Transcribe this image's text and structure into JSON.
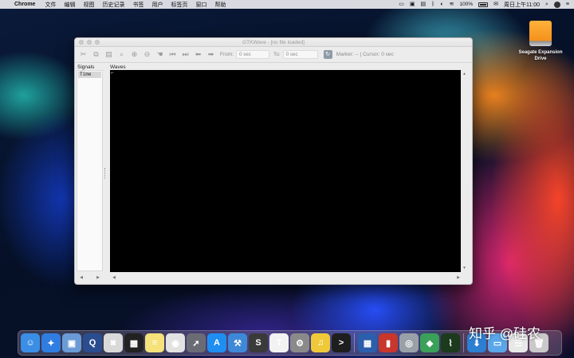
{
  "menubar": {
    "app_name": "Chrome",
    "items": [
      "文件",
      "编辑",
      "视图",
      "历史记录",
      "书签",
      "用户",
      "标签页",
      "窗口",
      "帮助"
    ],
    "battery_percent": "100%",
    "clock": "周日上午11:00",
    "status_icons": [
      "bluetooth-icon",
      "wifi-icon",
      "battery-icon",
      "input-source-icon",
      "search-icon",
      "user-avatar-icon",
      "notification-icon"
    ]
  },
  "desktop": {
    "drive_label": "Seagate Expansion Drive"
  },
  "window": {
    "title": "GTKWave - [no file loaded]",
    "toolbar": {
      "from_label": "From:",
      "from_value": "0 sec",
      "to_label": "To:",
      "to_value": "0 sec",
      "marker_label": "Marker: --  |  Cursor: 0 sec",
      "buttons": [
        "cut-icon",
        "copy-icon",
        "paste-icon",
        "zoom-fit-icon",
        "zoom-in-icon",
        "zoom-out-icon",
        "zoom-undo-icon",
        "jump-start-icon",
        "jump-end-icon",
        "page-left-icon",
        "page-right-icon"
      ]
    },
    "signals_header": "Signals",
    "signals": [
      "Time"
    ],
    "waves_header": "Waves",
    "waves_bg": "#000000"
  },
  "dock": {
    "apps": [
      {
        "name": "finder-icon",
        "color": "#3a8ee6",
        "glyph": "☺"
      },
      {
        "name": "safari-icon",
        "color": "#2f7de1",
        "glyph": "✦"
      },
      {
        "name": "preview-icon",
        "color": "#6a9bd6",
        "glyph": "▣"
      },
      {
        "name": "quicktime-icon",
        "color": "#2a4d8f",
        "glyph": "Q"
      },
      {
        "name": "photo-booth-icon",
        "color": "#d9d9d9",
        "glyph": "◙"
      },
      {
        "name": "photo-app-icon",
        "color": "#222222",
        "glyph": "▩"
      },
      {
        "name": "notes-icon",
        "color": "#f5e27a",
        "glyph": "≡"
      },
      {
        "name": "chrome-icon",
        "color": "#e2e2e2",
        "glyph": "◉"
      },
      {
        "name": "launchpad-icon",
        "color": "#6b6b75",
        "glyph": "➚"
      },
      {
        "name": "app-store-icon",
        "color": "#1f8ef1",
        "glyph": "A"
      },
      {
        "name": "xcode-icon",
        "color": "#3e88d8",
        "glyph": "⚒"
      },
      {
        "name": "sublime-icon",
        "color": "#3a3a3a",
        "glyph": "S"
      },
      {
        "name": "typora-icon",
        "color": "#f2f2f2",
        "glyph": "T"
      },
      {
        "name": "system-preferences-icon",
        "color": "#8a8a8a",
        "glyph": "⚙"
      },
      {
        "name": "music-player-icon",
        "color": "#f0c93a",
        "glyph": "♫"
      },
      {
        "name": "terminal-icon",
        "color": "#1e1e1e",
        "glyph": ">"
      },
      {
        "name": "virtualbox-icon",
        "color": "#2b5fab",
        "glyph": "▦"
      },
      {
        "name": "photo-booth-red-icon",
        "color": "#c8362c",
        "glyph": "▮"
      },
      {
        "name": "disk-utility-icon",
        "color": "#9aa0a8",
        "glyph": "◎"
      },
      {
        "name": "vivado-icon",
        "color": "#3aa05a",
        "glyph": "◆"
      },
      {
        "name": "gtkwave-icon",
        "color": "#1c3a1c",
        "glyph": "⌇"
      },
      {
        "name": "downloads-icon",
        "color": "#2d7fd2",
        "glyph": "⬇"
      },
      {
        "name": "folder-icon",
        "color": "#5aa6e8",
        "glyph": "▭"
      },
      {
        "name": "documents-icon",
        "color": "#e8e8e8",
        "glyph": "☰"
      },
      {
        "name": "trash-icon",
        "color": "#c9c9c9",
        "glyph": "🗑"
      }
    ]
  },
  "watermark": "知乎 @硅农"
}
